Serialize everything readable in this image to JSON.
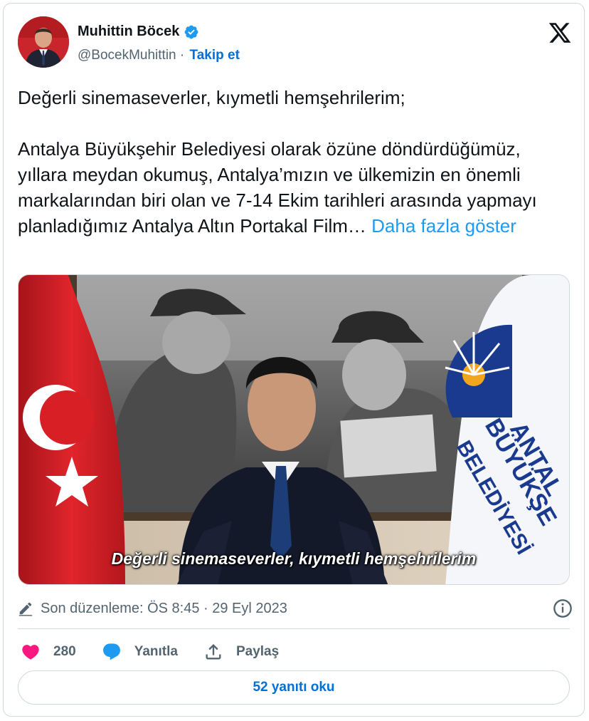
{
  "author": {
    "name": "Muhittin Böcek",
    "handle": "@BocekMuhittin",
    "separator": " · ",
    "follow_label": "Takip et",
    "verified": true
  },
  "tweet": {
    "line1": "Değerli sinemaseverler, kıymetli hemşehrilerim;",
    "line2": "Antalya Büyükşehir Belediyesi olarak özüne döndürdüğümüz, yıllara meydan okumuş, Antalya’mızın ve ülkemizin en önemli markalarından biri olan ve 7-14 Ekim tarihleri arasında yapmayı planladığımız Antalya Altın Portakal Film…",
    "show_more": "Daha fazla göster"
  },
  "media": {
    "caption": "Değerli sinemaseverler, kıymetli hemşehrilerim",
    "flag_text_lines": [
      "ANTAL",
      "BÜYÜKŞE",
      "BELEDİYESİ"
    ]
  },
  "meta": {
    "edited_label": "Son düzenleme: ÖS 8:45 · 29 Eyl 2023"
  },
  "actions": {
    "likes": "280",
    "reply_label": "Yanıtla",
    "share_label": "Paylaş"
  },
  "replies_button": "52 yanıtı oku",
  "colors": {
    "accent": "#1d9bf0",
    "link": "#006fd6",
    "like": "#f91880",
    "muted": "#536471",
    "border": "#cfd9de"
  },
  "icons": [
    "verified-badge-icon",
    "x-logo-icon",
    "pencil-icon",
    "info-icon",
    "heart-icon",
    "reply-bubble-icon",
    "share-icon"
  ]
}
